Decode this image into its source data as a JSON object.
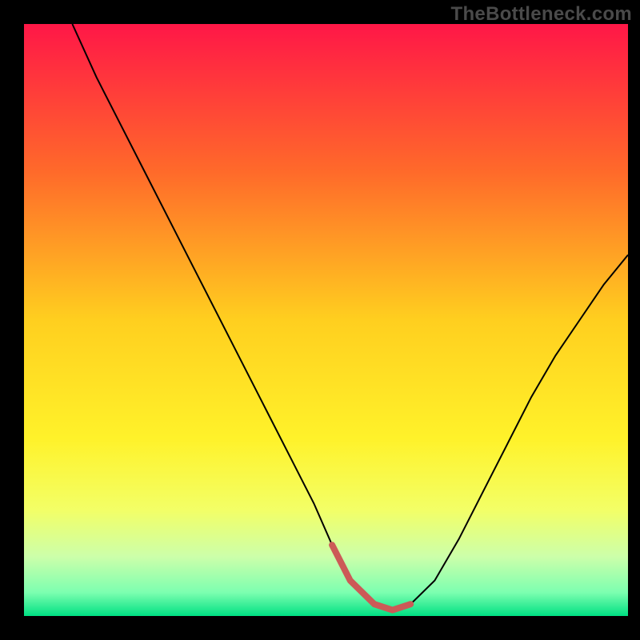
{
  "watermark": "TheBottleneck.com",
  "chart_data": {
    "type": "line",
    "title": "",
    "xlabel": "",
    "ylabel": "",
    "xlim": [
      0,
      100
    ],
    "ylim": [
      0,
      100
    ],
    "background_gradient": {
      "direction": "vertical",
      "stops": [
        {
          "offset": 0.0,
          "color": "#ff1747"
        },
        {
          "offset": 0.25,
          "color": "#ff6a2a"
        },
        {
          "offset": 0.5,
          "color": "#ffcf1f"
        },
        {
          "offset": 0.7,
          "color": "#fff22a"
        },
        {
          "offset": 0.82,
          "color": "#f3ff66"
        },
        {
          "offset": 0.9,
          "color": "#ccffaa"
        },
        {
          "offset": 0.96,
          "color": "#7dffb0"
        },
        {
          "offset": 1.0,
          "color": "#00e083"
        }
      ]
    },
    "series": [
      {
        "name": "bottleneck-curve",
        "color": "#000000",
        "width": 2,
        "x": [
          8,
          12,
          16,
          20,
          24,
          28,
          32,
          36,
          40,
          44,
          48,
          51,
          54,
          58,
          61,
          64,
          68,
          72,
          76,
          80,
          84,
          88,
          92,
          96,
          100
        ],
        "y": [
          100,
          91,
          83,
          75,
          67,
          59,
          51,
          43,
          35,
          27,
          19,
          12,
          6,
          2,
          1,
          2,
          6,
          13,
          21,
          29,
          37,
          44,
          50,
          56,
          61
        ]
      }
    ],
    "highlight_segment": {
      "name": "optimal-range",
      "color": "#cc5a57",
      "width": 8,
      "cap": "round",
      "x": [
        51,
        54,
        58,
        61,
        64
      ],
      "y": [
        12,
        6,
        2,
        1,
        2
      ]
    }
  }
}
